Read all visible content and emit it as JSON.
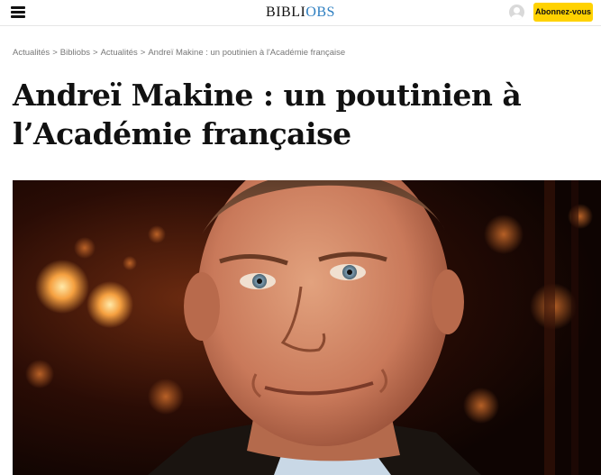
{
  "header": {
    "logo_part1": "BIBLI",
    "logo_part2": "OBS",
    "subscribe_label": "Abonnez-vous",
    "menu_icon": "hamburger-icon",
    "user_icon": "user-icon",
    "accent_color": "#ffd200",
    "logo_accent_color": "#2e7fc1"
  },
  "breadcrumb": {
    "items": [
      "Actualités",
      "Bibliobs",
      "Actualités",
      "Andreï Makine : un poutinien à l'Académie française"
    ],
    "separator": ">"
  },
  "article": {
    "title_line1": "Andreï Makine : un poutinien à",
    "title_line2": "l’Académie française"
  }
}
